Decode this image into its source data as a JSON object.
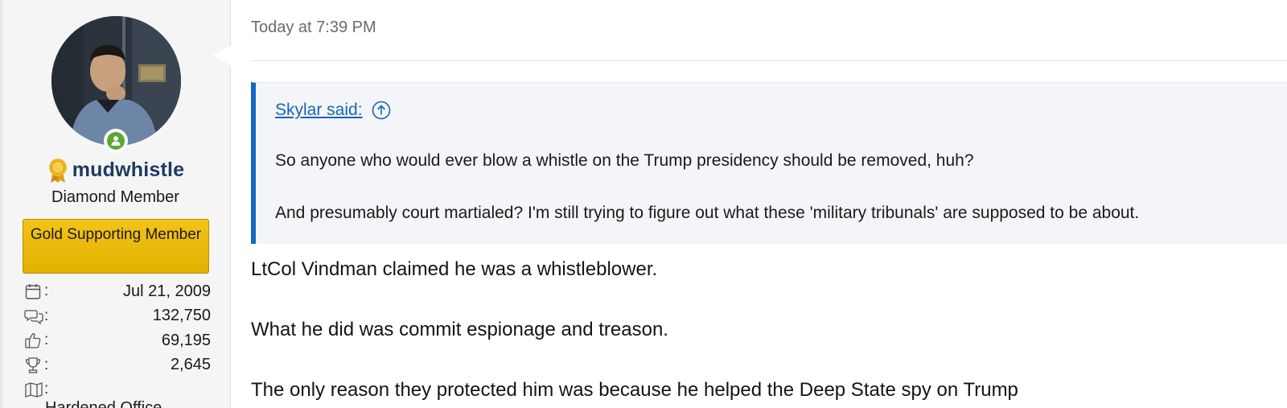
{
  "user": {
    "avatar_alt": "avatar",
    "online_icon": "person-online-icon",
    "medal_icon": "gold-medal-icon",
    "username": "mudwhistle",
    "title": "Diamond Member",
    "banner": "Gold Supporting Member",
    "stats": [
      {
        "icon": "calendar-icon",
        "colon": ":",
        "value": "Jul 21, 2009"
      },
      {
        "icon": "messages-icon",
        "colon": ":",
        "value": "132,750"
      },
      {
        "icon": "thumbs-up-icon",
        "colon": ":",
        "value": "69,195"
      },
      {
        "icon": "trophy-icon",
        "colon": ":",
        "value": "2,645"
      },
      {
        "icon": "map-icon",
        "colon": ":",
        "value": ""
      }
    ],
    "location_partial": "Hardened Office"
  },
  "post": {
    "time": "Today at 7:39 PM",
    "quote": {
      "author_link": "Skylar said:",
      "jump_icon": "arrow-up-circle-icon",
      "lines": [
        "So anyone who would ever blow a whistle on the Trump presidency should be removed, huh?",
        "And presumably court martialed? I'm still trying to figure out what these 'military tribunals' are supposed to be about."
      ]
    },
    "body": [
      "LtCol Vindman claimed he was a whistleblower.",
      "What he did was commit espionage and treason.",
      "The only reason they protected him was because he helped the Deep State spy on Trump"
    ]
  },
  "colors": {
    "link": "#1466b8",
    "quote_border": "#1268c4",
    "banner": "#e9b90c",
    "online": "#5aa835",
    "username": "#1e3a5f"
  }
}
